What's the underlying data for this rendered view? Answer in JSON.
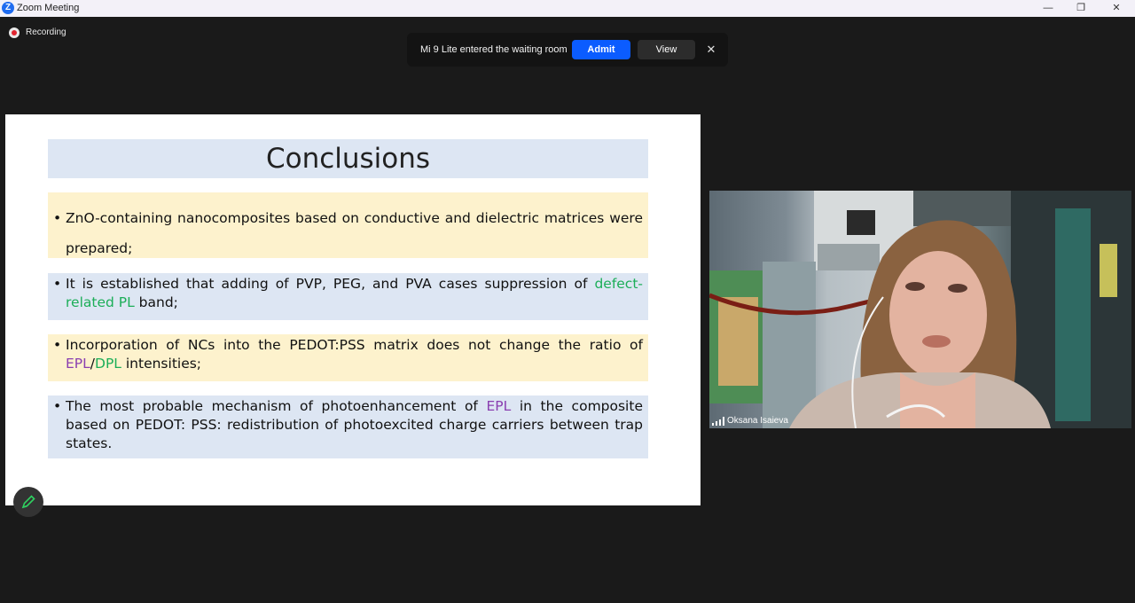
{
  "window": {
    "app_title": "Zoom Meeting",
    "icon_letter": "Z",
    "minimize_glyph": "—",
    "restore_glyph": "❐",
    "close_glyph": "✕"
  },
  "recording": {
    "label": "Recording"
  },
  "waiting_room_toast": {
    "message": "Mi 9 Lite entered the waiting room",
    "admit_label": "Admit",
    "view_label": "View",
    "close_glyph": "✕"
  },
  "slide": {
    "title": "Conclusions",
    "bullets": [
      {
        "parts": [
          {
            "text": "ZnO-containing nanocomposites based on conductive and dielectric matrices were prepared;"
          }
        ]
      },
      {
        "parts": [
          {
            "text": "It is established that adding of PVP, PEG, and PVA cases suppression of "
          },
          {
            "text": "defect-related PL",
            "color": "green"
          },
          {
            "text": " band;"
          }
        ]
      },
      {
        "parts": [
          {
            "text": "Incorporation of NCs into the PEDOT:PSS matrix does not change the ratio of "
          },
          {
            "text": "EPL",
            "color": "purple"
          },
          {
            "text": "/"
          },
          {
            "text": "DPL",
            "color": "green"
          },
          {
            "text": " intensities;"
          }
        ]
      },
      {
        "parts": [
          {
            "text": "The most probable mechanism of photoenhancement of "
          },
          {
            "text": "EPL",
            "color": "purple"
          },
          {
            "text": " in the composite based on PEDOT: PSS: redistribution of photoexcited charge carriers between trap states."
          }
        ]
      }
    ]
  },
  "participant": {
    "name": "Oksana Isaieva"
  },
  "colors": {
    "accent": "#0b5cff",
    "highlight_green": "#1cae58",
    "highlight_purple": "#8a3fb0",
    "slide_blue_box": "#dde6f3",
    "slide_yellow_box": "#fdf2cd",
    "recording_red": "#e0242f"
  },
  "icons": {
    "app": "zoom-logo-icon",
    "recording": "recording-dot-icon",
    "annotate": "pencil-icon",
    "signal": "signal-bars-icon"
  }
}
